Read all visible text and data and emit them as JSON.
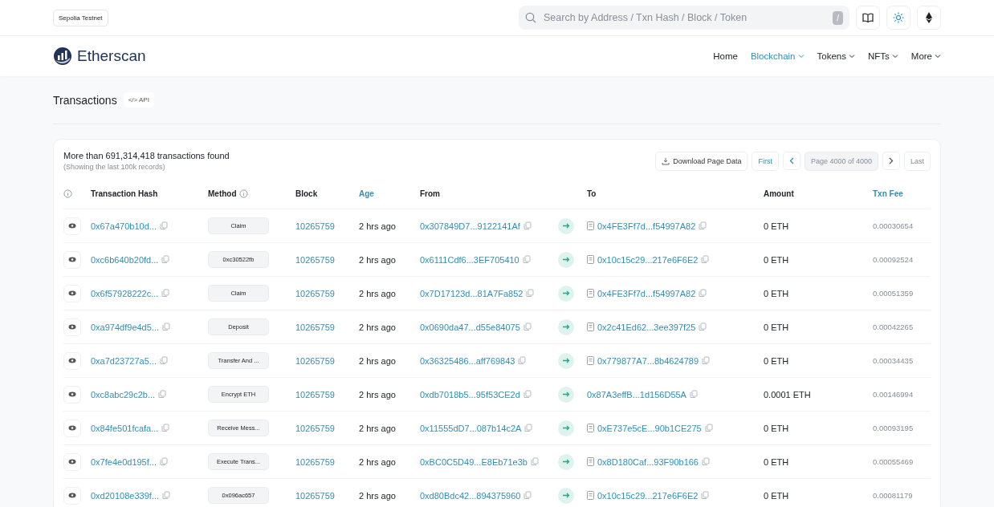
{
  "network_badge": "Sepolia Testnet",
  "search": {
    "placeholder": "Search by Address / Txn Hash / Block / Token",
    "shortcut": "/"
  },
  "logo": {
    "name": "Etherscan"
  },
  "nav": [
    {
      "label": "Home",
      "selected": false,
      "dropdown": false
    },
    {
      "label": "Blockchain",
      "selected": true,
      "dropdown": true
    },
    {
      "label": "Tokens",
      "selected": false,
      "dropdown": true
    },
    {
      "label": "NFTs",
      "selected": false,
      "dropdown": true
    },
    {
      "label": "More",
      "selected": false,
      "dropdown": true
    }
  ],
  "page_title": "Transactions",
  "api_button": "</> API",
  "summary": {
    "count": "More than 691,314,418 transactions found",
    "note": "(Showing the last 100k records)"
  },
  "download_button": "Download Page Data",
  "pagination": {
    "first": "First",
    "page": "Page 4000 of 4000",
    "last": "Last"
  },
  "table": {
    "columns": [
      {
        "kind": "info"
      },
      {
        "label": "Transaction Hash",
        "kind": "text",
        "link": false
      },
      {
        "label": "Method",
        "kind": "info",
        "link": false
      },
      {
        "label": "Block",
        "kind": "text",
        "link": false
      },
      {
        "label": "Age",
        "kind": "text",
        "link": true
      },
      {
        "label": "From",
        "kind": "text",
        "link": false
      },
      {
        "kind": "spacer"
      },
      {
        "label": "To",
        "kind": "text",
        "link": false
      },
      {
        "label": "Amount",
        "kind": "text",
        "link": false
      },
      {
        "label": "Txn Fee",
        "kind": "text",
        "link": true
      }
    ],
    "rows": [
      {
        "hash": "0x67a470b10d...",
        "method": "Claim",
        "block": "10265759",
        "age": "2 hrs ago",
        "from": "0x307849D7...9122141Af",
        "to": "0x4FE3Ff7d...f54997A82",
        "contract": true,
        "amount": "0 ETH",
        "fee": "0.00030654"
      },
      {
        "hash": "0xc6b640b20fd...",
        "method": "0xc30522fb",
        "block": "10265759",
        "age": "2 hrs ago",
        "from": "0x6111Cdf6...3EF705410",
        "to": "0x10c15c29...217e6F6E2",
        "contract": true,
        "amount": "0 ETH",
        "fee": "0.00092524"
      },
      {
        "hash": "0x6f57928222c...",
        "method": "Claim",
        "block": "10265759",
        "age": "2 hrs ago",
        "from": "0x7D17123d...81A7Fa852",
        "to": "0x4FE3Ff7d...f54997A82",
        "contract": true,
        "amount": "0 ETH",
        "fee": "0.00051359"
      },
      {
        "hash": "0xa974df9e4d5...",
        "method": "Deposit",
        "block": "10265759",
        "age": "2 hrs ago",
        "from": "0x0690da47...d55e84075",
        "to": "0x2c41Ed62...3ee397f25",
        "contract": true,
        "amount": "0 ETH",
        "fee": "0.00042265"
      },
      {
        "hash": "0xa7d23727a5...",
        "method": "Transfer And ...",
        "block": "10265759",
        "age": "2 hrs ago",
        "from": "0x36325486...aff769843",
        "to": "0x779877A7...8b4624789",
        "contract": true,
        "amount": "0 ETH",
        "fee": "0.00034435"
      },
      {
        "hash": "0xc8abc29c2b...",
        "method": "Encrypt ETH",
        "block": "10265759",
        "age": "2 hrs ago",
        "from": "0xdb7018b5...95f53CE2d",
        "to": "0x87A3effB...1d156D55A",
        "contract": false,
        "amount": "0.0001 ETH",
        "fee": "0.00146994"
      },
      {
        "hash": "0x84fe501fcafa...",
        "method": "Receive Mess...",
        "block": "10265759",
        "age": "2 hrs ago",
        "from": "0x11555dD7...087b14c2A",
        "to": "0xE737e5cE...90b1CE275",
        "contract": true,
        "amount": "0 ETH",
        "fee": "0.00093195"
      },
      {
        "hash": "0x7fe4e0d195f...",
        "method": "Execute Trans...",
        "block": "10265759",
        "age": "2 hrs ago",
        "from": "0xBC0C5D49...E8Eb71e3b",
        "to": "0x8D180Caf...93F90b166",
        "contract": true,
        "amount": "0 ETH",
        "fee": "0.00055469"
      },
      {
        "hash": "0xd20108e339f...",
        "method": "0x096ac657",
        "block": "10265759",
        "age": "2 hrs ago",
        "from": "0xd80Bdc42...894375960",
        "to": "0x10c15c29...217e6F6E2",
        "contract": true,
        "amount": "0 ETH",
        "fee": "0.00081179"
      }
    ]
  }
}
